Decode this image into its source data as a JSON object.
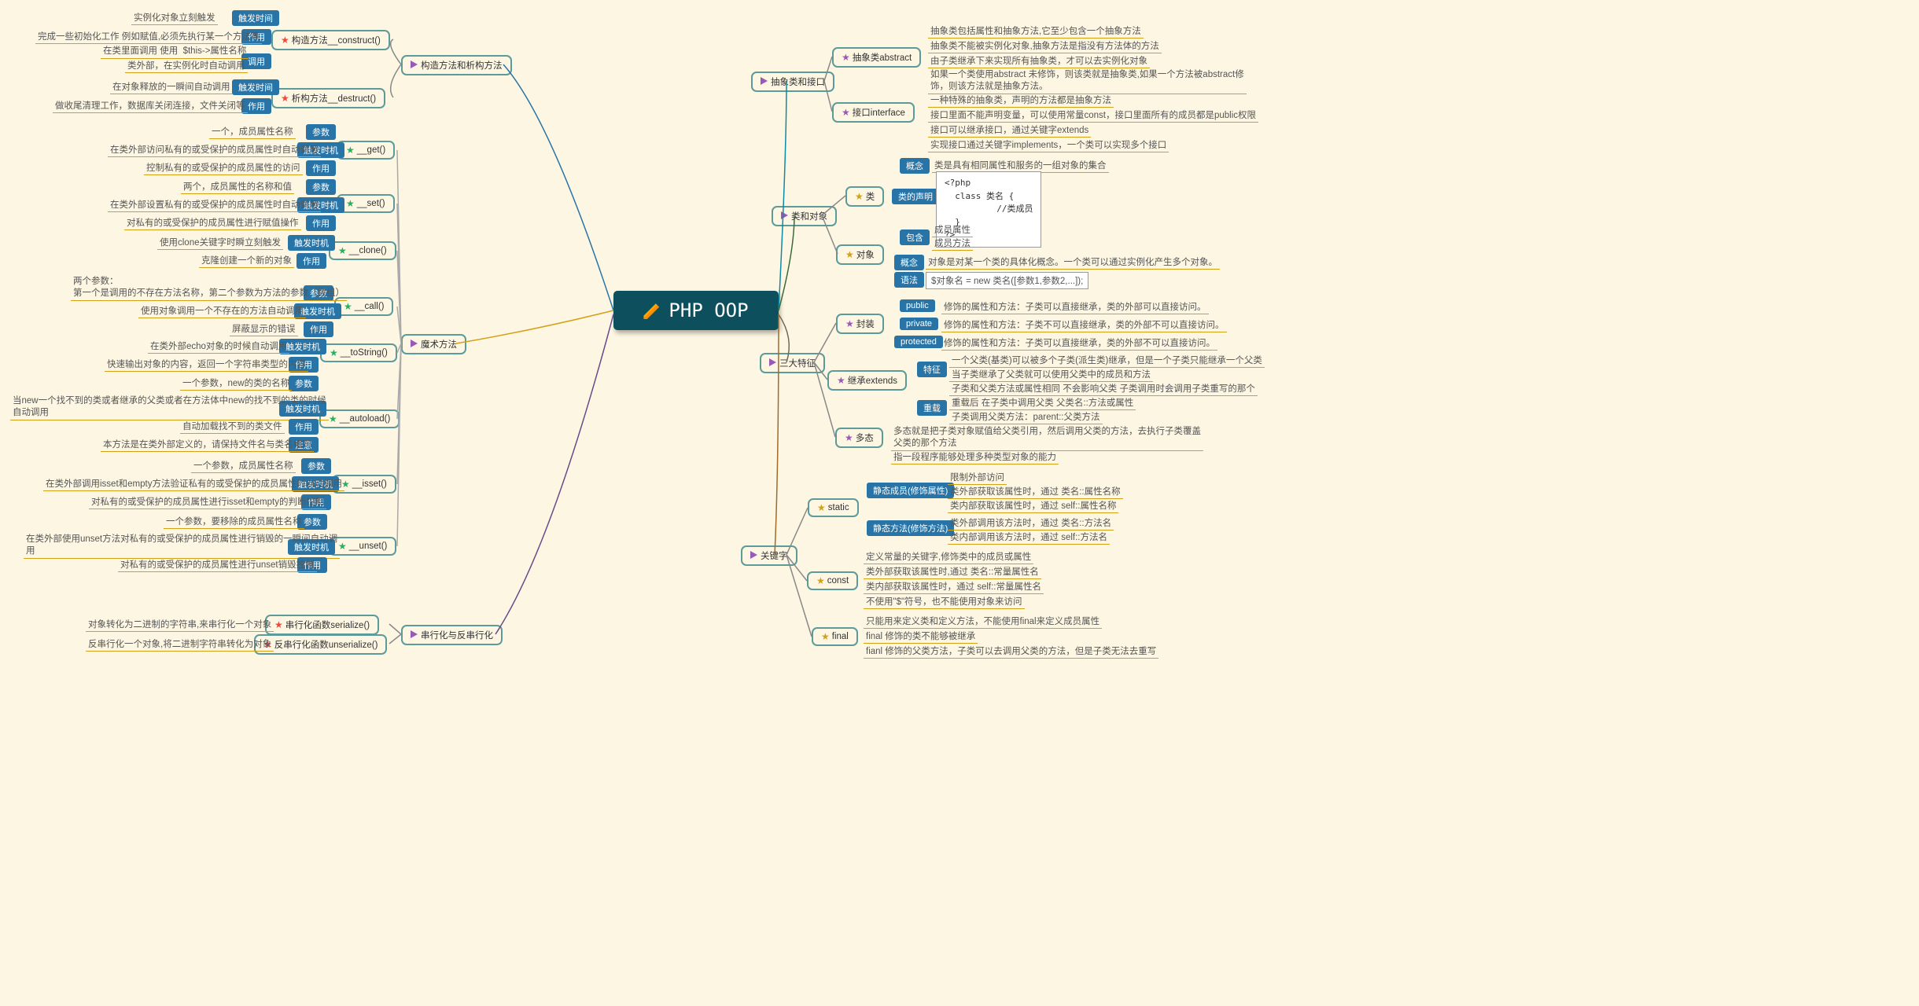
{
  "center": "PHP OOP",
  "L": {
    "br1": {
      "t": "构造方法和析构方法",
      "c": [
        {
          "t": "构造方法__construct()",
          "s": "red",
          "k": [
            [
              "触发时间",
              "实例化对象立刻触发"
            ],
            [
              "作用",
              "完成一些初始化工作  例如赋值,必须先执行某一个方法等"
            ],
            [
              "调用",
              "在类里面调用 使用  $this->属性名称\n类外部，在实例化时自动调用"
            ]
          ]
        },
        {
          "t": "析构方法__destruct()",
          "s": "red",
          "k": [
            [
              "触发时间",
              "在对象释放的一瞬间自动调用"
            ],
            [
              "作用",
              "做收尾清理工作，数据库关闭连接，文件关闭等"
            ]
          ]
        }
      ]
    },
    "br2": {
      "t": "魔术方法",
      "c": [
        {
          "t": "__get()",
          "s": "green",
          "k": [
            [
              "参数",
              "一个，成员属性名称"
            ],
            [
              "触发时机",
              "在类外部访问私有的或受保护的成员属性时自动调用"
            ],
            [
              "作用",
              "控制私有的或受保护的成员属性的访问"
            ]
          ]
        },
        {
          "t": "__set()",
          "s": "green",
          "k": [
            [
              "参数",
              "两个，成员属性的名称和值"
            ],
            [
              "触发时机",
              "在类外部设置私有的或受保护的成员属性时自动调用"
            ],
            [
              "作用",
              "对私有的或受保护的成员属性进行赋值操作"
            ]
          ]
        },
        {
          "t": "__clone()",
          "s": "green",
          "k": [
            [
              "触发时机",
              "使用clone关键字时瞬立刻触发"
            ],
            [
              "作用",
              "克隆创建一个新的对象"
            ]
          ]
        },
        {
          "t": "__call()",
          "s": "green",
          "k": [
            [
              "参数",
              "两个参数：\n第一个是调用的不存在方法名称，第二个参数为方法的参数（数组）"
            ],
            [
              "触发时机",
              "使用对象调用一个不存在的方法自动调用"
            ],
            [
              "作用",
              "屏蔽显示的错误"
            ]
          ]
        },
        {
          "t": "__toString()",
          "s": "green",
          "k": [
            [
              "触发时机",
              "在类外部echo对象的时候自动调用"
            ],
            [
              "作用",
              "快速输出对象的内容，返回一个字符串类型的内容"
            ]
          ]
        },
        {
          "t": "__autoload()",
          "s": "green",
          "k": [
            [
              "参数",
              "一个参数，new的类的名称"
            ],
            [
              "触发时机",
              "当new一个找不到的类或者继承的父类或者在方法体中new的找不到的类的时候自动调用"
            ],
            [
              "作用",
              "自动加载找不到的类文件"
            ],
            [
              "注意",
              "本方法是在类外部定义的，请保持文件名与类名相同"
            ]
          ]
        },
        {
          "t": "__isset()",
          "s": "green",
          "k": [
            [
              "参数",
              "一个参数，成员属性名称"
            ],
            [
              "触发时机",
              "在类外部调用isset和empty方法验证私有的或受保护的成员属性时自动调用"
            ],
            [
              "作用",
              "对私有的或受保护的成员属性进行isset和empty的判断控制"
            ]
          ]
        },
        {
          "t": "__unset()",
          "s": "green",
          "k": [
            [
              "参数",
              "一个参数，要移除的成员属性名称"
            ],
            [
              "触发时机",
              "在类外部使用unset方法对私有的或受保护的成员属性进行销毁的一瞬间自动调用"
            ],
            [
              "作用",
              "对私有的或受保护的成员属性进行unset销毁控制"
            ]
          ]
        }
      ]
    },
    "br3": {
      "t": "串行化与反串行化",
      "c": [
        {
          "t": "串行化函数serialize()",
          "s": "red",
          "leaf": "对象转化为二进制的字符串,来串行化一个对象"
        },
        {
          "t": "反串行化函数unserialize()",
          "s": "red",
          "leaf": "反串行化一个对象,将二进制字符串转化为对象"
        }
      ]
    }
  },
  "R": {
    "br4": {
      "t": "抽象类和接口",
      "c": [
        {
          "t": "抽象类abstract",
          "s": "purple",
          "leaves": [
            "抽象类包括属性和抽象方法,它至少包含一个抽象方法",
            "抽象类不能被实例化对象,抽象方法是指没有方法体的方法",
            "由子类继承下来实现所有抽象类，才可以去实例化对象",
            "如果一个类使用abstract 未修饰，则该类就是抽象类,如果一个方法被abstract修饰，则该方法就是抽象方法。"
          ]
        },
        {
          "t": "接口interface",
          "s": "purple",
          "leaves": [
            "一种特殊的抽象类，声明的方法都是抽象方法",
            "接口里面不能声明变量，可以使用常量const，接口里面所有的成员都是public权限",
            "接口可以继承接口，通过关键字extends",
            "实现接口通过关键字implements，一个类可以实现多个接口"
          ]
        }
      ]
    },
    "br5": {
      "t": "类和对象",
      "c": [
        {
          "t": "类",
          "s": "gold",
          "sub": [
            [
              "概念",
              "类是具有相同属性和服务的一组对象的集合"
            ],
            [
              "类的声明",
              "<?php\n  class 类名 {\n          //类成员\n  }\n?>"
            ],
            [
              "包含",
              "成员属性\n成员方法"
            ]
          ]
        },
        {
          "t": "对象",
          "s": "gold",
          "sub": [
            [
              "概念",
              "对象是对某一个类的具体化概念。一个类可以通过实例化产生多个对象。"
            ],
            [
              "语法",
              "$对象名 = new 类名([参数1,参数2,...]);"
            ]
          ]
        }
      ]
    },
    "br6": {
      "t": "三大特征",
      "c": [
        {
          "t": "封装",
          "s": "purple",
          "sub": [
            [
              "public",
              "修饰的属性和方法：子类可以直接继承，类的外部可以直接访问。"
            ],
            [
              "private",
              "修饰的属性和方法：子类不可以直接继承，类的外部不可以直接访问。"
            ],
            [
              "protected",
              "修饰的属性和方法：子类可以直接继承，类的外部不可以直接访问。"
            ]
          ]
        },
        {
          "t": "继承extends",
          "s": "purple",
          "sub": [
            [
              "特征",
              "一个父类(基类)可以被多个子类(派生类)继承，但是一个子类只能继承一个父类\n当子类继承了父类就可以使用父类中的成员和方法\n子类和父类方法或属性相同 不会影响父类  子类调用时会调用子类重写的那个"
            ],
            [
              "重载",
              "重载后 在子类中调用父类  父类名::方法或属性\n子类调用父类方法：parent::父类方法"
            ]
          ]
        },
        {
          "t": "多态",
          "s": "purple",
          "leaves": [
            "多态就是把子类对象赋值给父类引用，然后调用父类的方法，去执行子类覆盖父类的那个方法",
            "指一段程序能够处理多种类型对象的能力"
          ]
        }
      ]
    },
    "br7": {
      "t": "关键字",
      "c": [
        {
          "t": "static",
          "s": "gold",
          "sub": [
            [
              "静态成员(修饰属性)",
              "限制外部访问\n类外部获取该属性时，通过 类名::属性名称\n类内部获取该属性时，通过 self::属性名称"
            ],
            [
              "静态方法(修饰方法)",
              "类外部调用该方法时，通过 类名::方法名\n类内部调用该方法时，通过 self::方法名"
            ]
          ]
        },
        {
          "t": "const",
          "s": "gold",
          "leaves": [
            "定义常量的关键字,修饰类中的成员或属性",
            "类外部获取该属性时,通过 类名::常量属性名",
            "类内部获取该属性时，通过 self::常量属性名",
            "不使用\"$\"符号，也不能使用对象来访问"
          ]
        },
        {
          "t": "final",
          "s": "gold",
          "leaves": [
            "只能用来定义类和定义方法，不能使用final来定义成员属性",
            "final 修饰的类不能够被继承",
            "fianl 修饰的父类方法，子类可以去调用父类的方法，但是子类无法去重写"
          ]
        }
      ]
    }
  }
}
